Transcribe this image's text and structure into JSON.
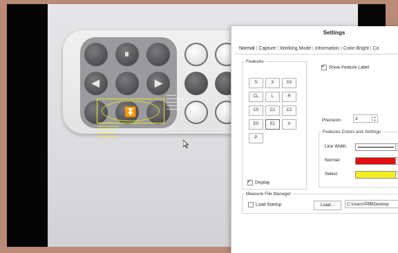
{
  "settings": {
    "title": "Settings",
    "tabs": [
      "Normal",
      "Capture",
      "Working Mode",
      "Information",
      "Color Bright",
      "Co"
    ],
    "features_legend": "Features",
    "feature_buttons": [
      "S",
      "X",
      "XX",
      "CL",
      "L",
      "R",
      "C0",
      "C1",
      "C2",
      "E0",
      "E1",
      "A",
      "P"
    ],
    "display_label": "Display",
    "display_checked": true,
    "show_feature_label": "Show Feature Label",
    "show_feature_checked": true,
    "precision_label": "Precision:",
    "precision_value": "3",
    "colors_legend": "Features Colors and Settings",
    "line_width_label": "Line Width:",
    "normal_label": "Normal:",
    "select_label": "Select:",
    "normal_color": "#e01010",
    "select_color": "#f4ef1a",
    "mfm_legend": "Measure File Manager",
    "load_startup_label": "Load Startup",
    "load_startup_checked": false,
    "load_button": "Load...",
    "path_value": "C:\\Users\\中国\\Desktop"
  },
  "icons": {
    "spinner": "spin-arrows-icon",
    "dropdown": "chevron-down-icon",
    "cursor": "mouse-pointer-icon"
  }
}
